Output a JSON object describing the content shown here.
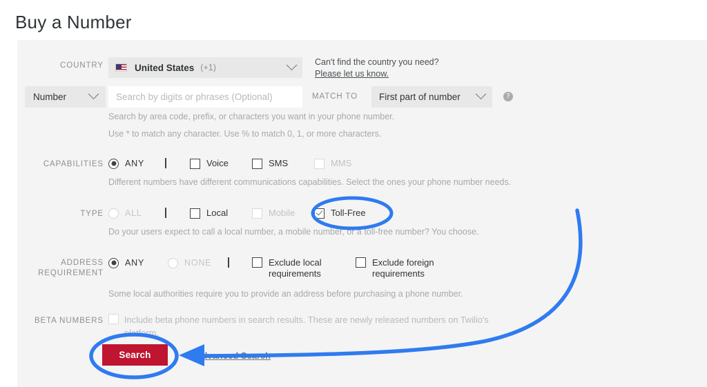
{
  "page": {
    "title": "Buy a Number"
  },
  "country_row": {
    "label": "COUNTRY",
    "selected": "United States",
    "dial_code": "(+1)",
    "flag_icon": "us-flag-icon",
    "chevron_icon": "chevron-down-icon",
    "help_question": "Can't find the country you need?",
    "help_link": "Please let us know."
  },
  "search_row": {
    "type_selected": "Number",
    "type_chevron_icon": "chevron-down-icon",
    "input_value": "",
    "input_placeholder": "Search by digits or phrases (Optional)",
    "match_to_label": "MATCH TO",
    "match_to_selected": "First part of number",
    "match_chevron_icon": "chevron-down-icon",
    "help_icon": "question-mark-icon",
    "help_icon_glyph": "?",
    "hint_1": "Search by area code, prefix, or characters you want in your phone number.",
    "hint_2": "Use * to match any character. Use % to match 0, 1, or more characters."
  },
  "capabilities_row": {
    "label": "CAPABILITIES",
    "any_label": "ANY",
    "any_selected": true,
    "options": [
      {
        "label": "Voice",
        "checked": false,
        "disabled": false
      },
      {
        "label": "SMS",
        "checked": false,
        "disabled": false
      },
      {
        "label": "MMS",
        "checked": false,
        "disabled": true
      }
    ],
    "hint": "Different numbers have different communications capabilities. Select the ones your phone number needs."
  },
  "type_row": {
    "label": "TYPE",
    "all_label": "ALL",
    "all_selected": false,
    "options": [
      {
        "label": "Local",
        "checked": false,
        "disabled": false
      },
      {
        "label": "Mobile",
        "checked": false,
        "disabled": true
      },
      {
        "label": "Toll-Free",
        "checked": true,
        "disabled": false
      }
    ],
    "hint": "Do your users expect to call a local number, a mobile number, or a toll-free number? You choose."
  },
  "address_row": {
    "label_line1": "ADDRESS",
    "label_line2": "REQUIREMENT",
    "any_label": "ANY",
    "any_selected": true,
    "none_label": "NONE",
    "none_selected": false,
    "options": [
      {
        "label": "Exclude local requirements",
        "checked": false
      },
      {
        "label": "Exclude foreign requirements",
        "checked": false
      }
    ],
    "hint": "Some local authorities require you to provide an address before purchasing a phone number."
  },
  "beta_row": {
    "label": "BETA NUMBERS",
    "checked": false,
    "text": "Include beta phone numbers in search results. These are newly released numbers on Twilio's platform."
  },
  "actions": {
    "search_label": "Search",
    "advanced_search_label": "Advanced Search"
  },
  "annotations": {
    "color": "#2f7bf0",
    "ellipse_toll_free": "highlight-ellipse-toll-free",
    "ellipse_search": "highlight-ellipse-search-button",
    "arrow": "curved-arrow-to-search"
  },
  "colors": {
    "panel_bg": "#f4f4f4",
    "page_bg": "#ffffff",
    "button_red": "#bf1530",
    "annotation_blue": "#2f7bf0",
    "muted_text": "#a5a9ac",
    "label_text": "#8b8f93"
  }
}
